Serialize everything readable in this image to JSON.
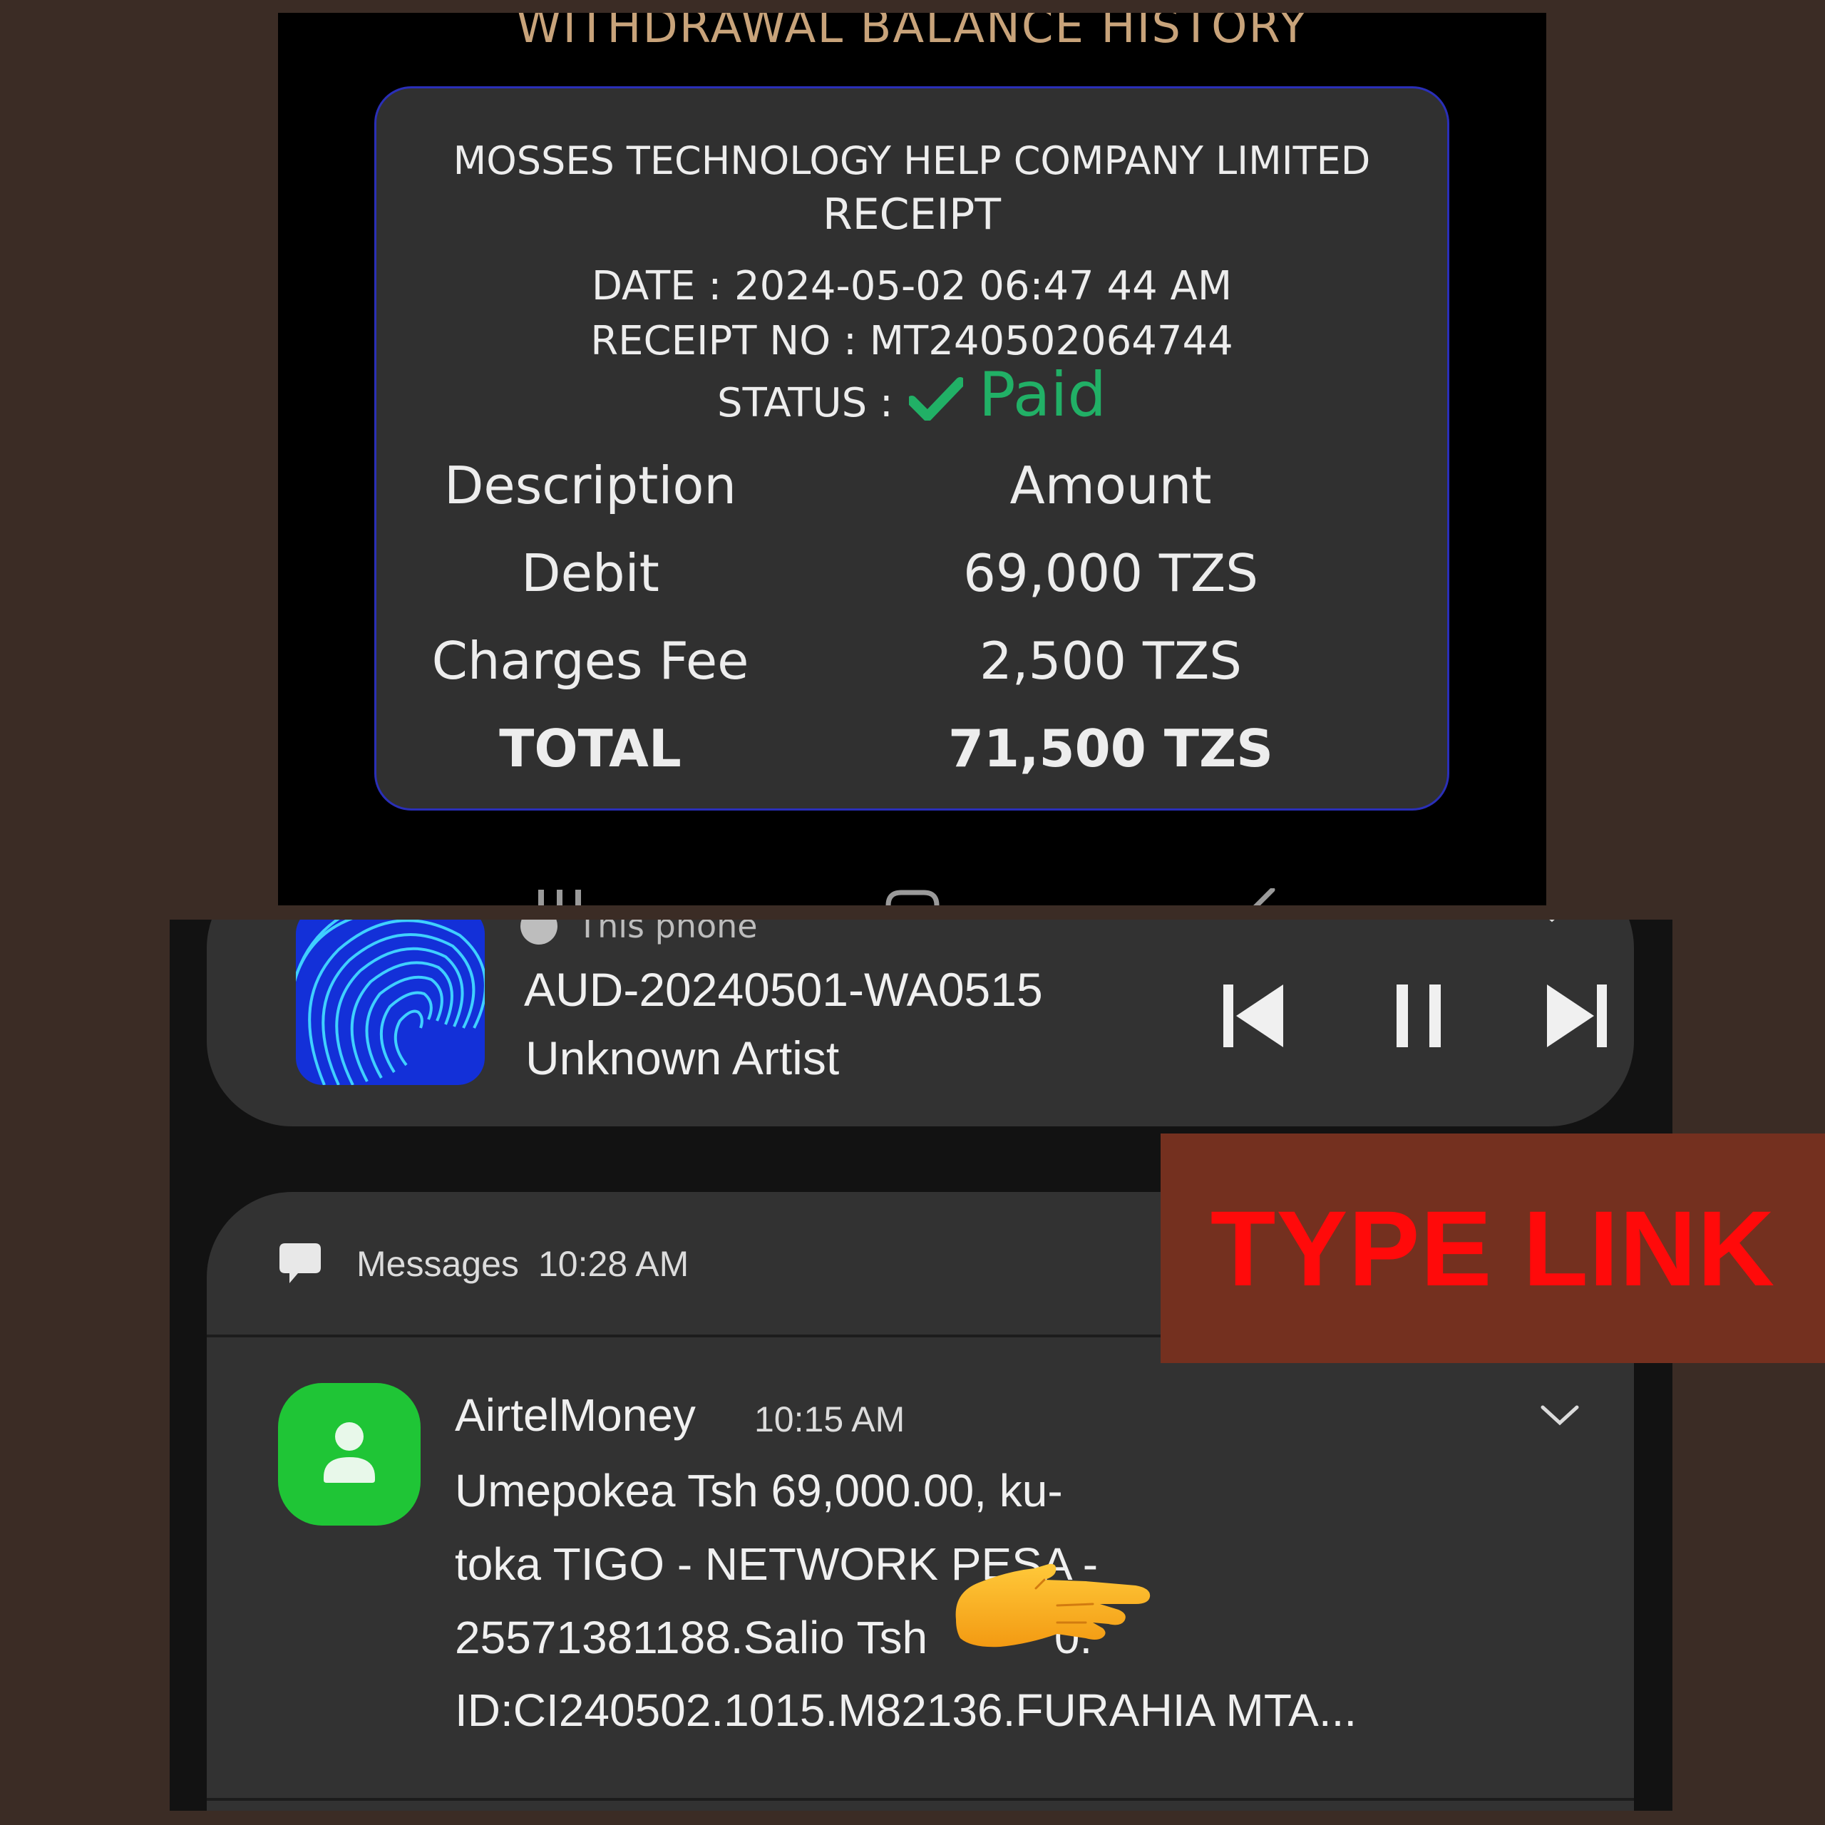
{
  "receipt_screen": {
    "page_title": "WITHDRAWAL BALANCE HISTORY",
    "company": "MOSSES TECHNOLOGY HELP COMPANY LIMITED",
    "heading": "RECEIPT",
    "date": "DATE : 2024-05-02 06:47 44 AM",
    "receipt_no": "RECEIPT NO : MT240502064744",
    "status_label": "STATUS :",
    "status_value": "Paid",
    "status_color": "#21b066",
    "columns": [
      "Description",
      "Amount"
    ],
    "rows": [
      {
        "description": "Debit",
        "amount": "69,000 TZS"
      },
      {
        "description": "Charges Fee",
        "amount": "2,500 TZS"
      },
      {
        "description": "TOTAL",
        "amount": "71,500 TZS"
      }
    ],
    "nav_icons": [
      "recent-apps-icon",
      "home-icon",
      "back-icon"
    ]
  },
  "notifications": {
    "media": {
      "source": "This phone",
      "title": "AUD-20240501-WA0515",
      "artist": "Unknown Artist",
      "controls": [
        "previous-icon",
        "pause-icon",
        "next-icon"
      ]
    },
    "messages": {
      "app": "Messages",
      "time": "10:28 AM",
      "sms": {
        "sender": "AirtelMoney",
        "time": "10:15 AM",
        "lines": [
          "Umepokea Tsh 69,000.00, ku-",
          "toka TIGO - NETWORK PESA -",
          "25571381188.Salio Tsh          0.",
          "ID:CI240502.1015.M82136.FURAHIA MTA..."
        ]
      }
    }
  },
  "overlay": {
    "label": "TYPE LINK",
    "text_color": "#ff0a0a",
    "background": "#74301f"
  }
}
